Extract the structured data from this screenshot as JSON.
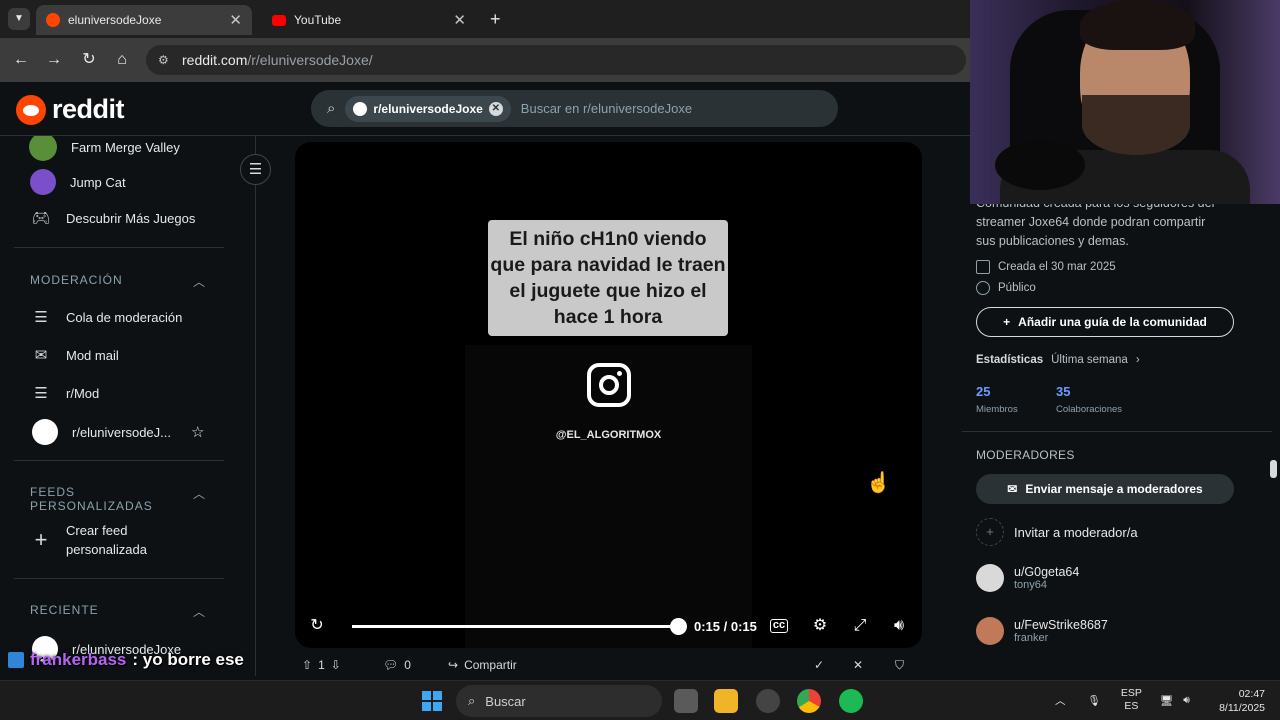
{
  "browser": {
    "tabs": [
      {
        "title": "eluniversodeJoxe",
        "active": true
      },
      {
        "title": "YouTube",
        "active": false
      }
    ],
    "url_domain": "reddit.com",
    "url_path": "/r/eluniversodeJoxe/"
  },
  "reddit": {
    "logo_text": "reddit",
    "search": {
      "chip": "r/eluniversodeJoxe",
      "placeholder": "Buscar en r/eluniversodeJoxe"
    }
  },
  "left_sidebar": {
    "games": [
      {
        "label": "Farm Merge Valley",
        "icon": "farm-game-icon"
      },
      {
        "label": "Jump Cat",
        "icon": "cat-game-icon"
      },
      {
        "label": "Descubrir Más Juegos",
        "icon": "gamepad-icon"
      }
    ],
    "moderation_header": "MODERACIÓN",
    "moderation_items": [
      {
        "label": "Cola de moderación",
        "icon": "queue-icon"
      },
      {
        "label": "Mod mail",
        "icon": "mail-icon"
      },
      {
        "label": "r/Mod",
        "icon": "mod-icon"
      },
      {
        "label": "r/eluniversodeJ...",
        "icon": "community-avatar"
      }
    ],
    "feeds_header": "FEEDS PERSONALIZADAS",
    "create_feed": "Crear feed personalizada",
    "recent_header": "RECIENTE",
    "recent_items": [
      "r/eluniversodeJoxe"
    ]
  },
  "video": {
    "caption": "El niño cH1n0 viendo que para navidad le traen el juguete que hizo el hace 1 hora",
    "watermark": "@EL_ALGORITMOX",
    "time": "0:15 / 0:15",
    "progress": 1.0
  },
  "post_actions": {
    "votes": "1",
    "comments": "0",
    "share": "Compartir"
  },
  "right_sidebar": {
    "description_lines": [
      "Comunidad creada para los seguidores del",
      "streamer Joxe64 donde podran compartir",
      "sus publicaciones y demas."
    ],
    "created": "Creada el 30 mar 2025",
    "visibility": "Público",
    "guide_button": "Añadir una guía de la comunidad",
    "stats_label": "Estadísticas",
    "stats_period": "Última semana",
    "members_count": "25",
    "members_label": "Miembros",
    "contrib_count": "35",
    "contrib_label": "Colaboraciones",
    "moderators_header": "MODERADORES",
    "message_button": "Enviar mensaje a moderadores",
    "invite": "Invitar a moderador/a",
    "moderators": [
      {
        "name": "u/G0geta64",
        "flair": "tony64",
        "color": "#d9d9d9"
      },
      {
        "name": "u/FewStrike8687",
        "flair": "franker",
        "color": "#c07a5a"
      }
    ]
  },
  "chat_overlay": {
    "user": "frankerbass",
    "message": ": yo borre ese"
  },
  "taskbar": {
    "search": "Buscar",
    "lang_top": "ESP",
    "lang_bottom": "ES",
    "time": "02:47",
    "date": "8/11/2025"
  },
  "colors": {
    "reddit_orange": "#ff4500",
    "link_blue": "#6b9cff",
    "bg": "#0e1113"
  }
}
